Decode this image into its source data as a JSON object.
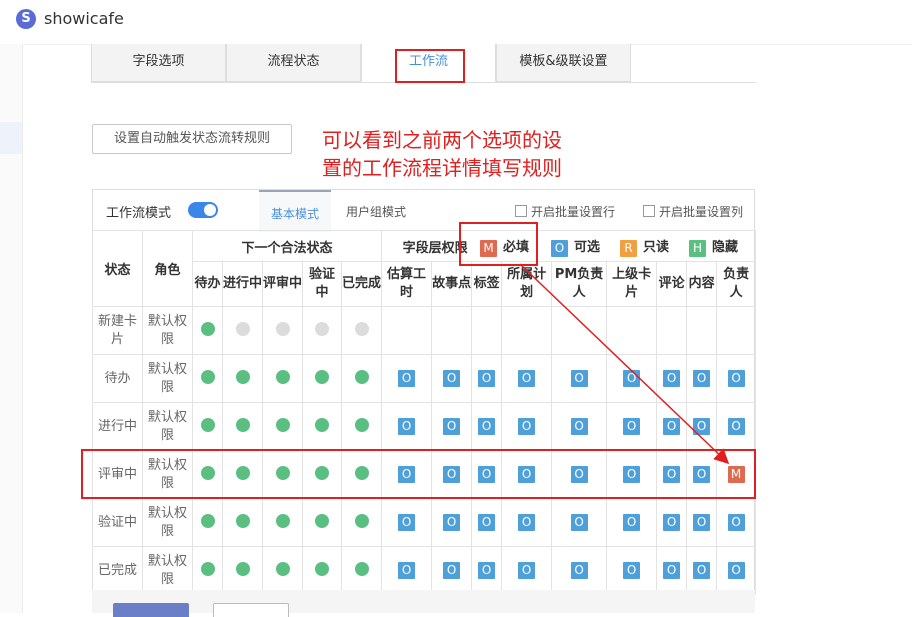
{
  "app": {
    "logo_letter": "S",
    "name": "showicafe"
  },
  "tabs": [
    "字段选项",
    "流程状态",
    "工作流",
    "模板&级联设置"
  ],
  "rule_button": "设置自动触发状态流转规则",
  "annotation": {
    "line1": "可以看到之前两个选项的设",
    "line2": "置的工作流程详情填写规则"
  },
  "workflow": {
    "mode_label": "工作流模式",
    "toggle_on": true,
    "subtabs": [
      "基本模式",
      "用户组模式"
    ],
    "batch_row": "开启批量设置行",
    "batch_col": "开启批量设置列"
  },
  "legend": [
    {
      "code": "M",
      "label": "必填"
    },
    {
      "code": "O",
      "label": "可选"
    },
    {
      "code": "R",
      "label": "只读"
    },
    {
      "code": "H",
      "label": "隐藏"
    }
  ],
  "table": {
    "status_header": "状态",
    "role_header": "角色",
    "next_states_header": "下一个合法状态",
    "field_perm_header": "字段层权限",
    "next_states": [
      "待办",
      "进行中",
      "评审中",
      "验证中",
      "已完成"
    ],
    "fields": [
      "估算工时",
      "故事点",
      "标签",
      "所属计划",
      "PM负责人",
      "上级卡片",
      "评论",
      "内容",
      "负责人"
    ],
    "rows": [
      {
        "status": "新建卡片",
        "role": "默认权限",
        "next": [
          1,
          0,
          0,
          0,
          0
        ],
        "perms": [
          "",
          "",
          "",
          "",
          "",
          "",
          "",
          "",
          ""
        ]
      },
      {
        "status": "待办",
        "role": "默认权限",
        "next": [
          1,
          1,
          1,
          1,
          1
        ],
        "perms": [
          "O",
          "O",
          "O",
          "O",
          "O",
          "O",
          "O",
          "O",
          "O"
        ]
      },
      {
        "status": "进行中",
        "role": "默认权限",
        "next": [
          1,
          1,
          1,
          1,
          1
        ],
        "perms": [
          "O",
          "O",
          "O",
          "O",
          "O",
          "O",
          "O",
          "O",
          "O"
        ]
      },
      {
        "status": "评审中",
        "role": "默认权限",
        "next": [
          1,
          1,
          1,
          1,
          1
        ],
        "perms": [
          "O",
          "O",
          "O",
          "O",
          "O",
          "O",
          "O",
          "O",
          "M"
        ]
      },
      {
        "status": "验证中",
        "role": "默认权限",
        "next": [
          1,
          1,
          1,
          1,
          1
        ],
        "perms": [
          "O",
          "O",
          "O",
          "O",
          "O",
          "O",
          "O",
          "O",
          "O"
        ]
      },
      {
        "status": "已完成",
        "role": "默认权限",
        "next": [
          1,
          1,
          1,
          1,
          1
        ],
        "perms": [
          "O",
          "O",
          "O",
          "O",
          "O",
          "O",
          "O",
          "O",
          "O"
        ]
      }
    ]
  },
  "colors": {
    "accent": "#3b87e8",
    "dot_on": "#5cbf82",
    "dot_off": "#dcdcdc",
    "perm_O": "#4f9fd8",
    "perm_M": "#de6a4f",
    "perm_R": "#f0a040",
    "perm_H": "#5cbf82",
    "annotation": "#e02020"
  }
}
